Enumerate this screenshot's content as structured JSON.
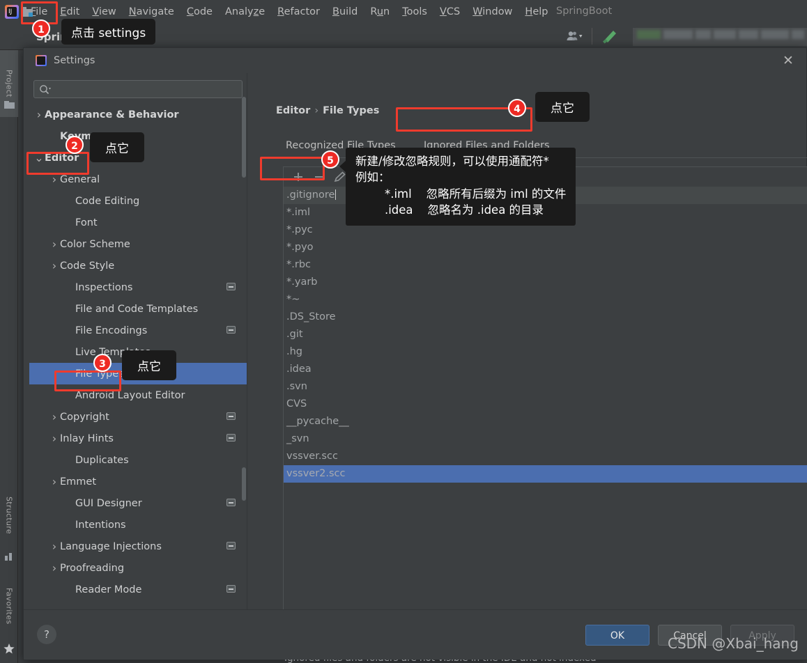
{
  "ide": {
    "menu_items": [
      {
        "label": "File",
        "mnemonic": "F"
      },
      {
        "label": "Edit",
        "mnemonic": "E"
      },
      {
        "label": "View",
        "mnemonic": "V"
      },
      {
        "label": "Navigate",
        "mnemonic": "N"
      },
      {
        "label": "Code",
        "mnemonic": "C"
      },
      {
        "label": "Analyze",
        "mnemonic": "z"
      },
      {
        "label": "Refactor",
        "mnemonic": "R"
      },
      {
        "label": "Build",
        "mnemonic": "B"
      },
      {
        "label": "Run",
        "mnemonic": "u"
      },
      {
        "label": "Tools",
        "mnemonic": "T"
      },
      {
        "label": "VCS",
        "mnemonic": "V"
      },
      {
        "label": "Window",
        "mnemonic": "W"
      },
      {
        "label": "Help",
        "mnemonic": "H"
      }
    ],
    "project_name": "SpringBoot",
    "toolbar_project_label": "SpringBoot",
    "tool_strips": [
      {
        "label": "Project",
        "icon": "folder-icon",
        "active": true
      },
      {
        "label": "Structure",
        "icon": "structure-icon",
        "active": false
      },
      {
        "label": "Favorites",
        "icon": "star-icon",
        "active": false
      }
    ]
  },
  "dialog": {
    "title": "Settings",
    "close_icon": "close-icon",
    "search": {
      "value": "",
      "placeholder": "",
      "icon": "search-icon"
    },
    "tree": [
      {
        "label": "Appearance & Behavior",
        "arrow": "collapsed",
        "indent": 0,
        "bold": true,
        "badge": false
      },
      {
        "label": "Keymap",
        "arrow": "none",
        "indent": 1,
        "bold": true,
        "badge": false
      },
      {
        "label": "Editor",
        "arrow": "expanded",
        "indent": 0,
        "bold": true,
        "badge": false
      },
      {
        "label": "General",
        "arrow": "collapsed",
        "indent": 1,
        "bold": false,
        "badge": false
      },
      {
        "label": "Code Editing",
        "arrow": "none",
        "indent": 2,
        "bold": false,
        "badge": false
      },
      {
        "label": "Font",
        "arrow": "none",
        "indent": 2,
        "bold": false,
        "badge": false
      },
      {
        "label": "Color Scheme",
        "arrow": "collapsed",
        "indent": 1,
        "bold": false,
        "badge": false
      },
      {
        "label": "Code Style",
        "arrow": "collapsed",
        "indent": 1,
        "bold": false,
        "badge": false
      },
      {
        "label": "Inspections",
        "arrow": "none",
        "indent": 2,
        "bold": false,
        "badge": true
      },
      {
        "label": "File and Code Templates",
        "arrow": "none",
        "indent": 2,
        "bold": false,
        "badge": false
      },
      {
        "label": "File Encodings",
        "arrow": "none",
        "indent": 2,
        "bold": false,
        "badge": true
      },
      {
        "label": "Live Templates",
        "arrow": "none",
        "indent": 2,
        "bold": false,
        "badge": false
      },
      {
        "label": "File Types",
        "arrow": "none",
        "indent": 2,
        "bold": false,
        "badge": false,
        "selected": true
      },
      {
        "label": "Android Layout Editor",
        "arrow": "none",
        "indent": 2,
        "bold": false,
        "badge": false
      },
      {
        "label": "Copyright",
        "arrow": "collapsed",
        "indent": 1,
        "bold": false,
        "badge": true
      },
      {
        "label": "Inlay Hints",
        "arrow": "collapsed",
        "indent": 1,
        "bold": false,
        "badge": true
      },
      {
        "label": "Duplicates",
        "arrow": "none",
        "indent": 2,
        "bold": false,
        "badge": false
      },
      {
        "label": "Emmet",
        "arrow": "collapsed",
        "indent": 1,
        "bold": false,
        "badge": false
      },
      {
        "label": "GUI Designer",
        "arrow": "none",
        "indent": 2,
        "bold": false,
        "badge": true
      },
      {
        "label": "Intentions",
        "arrow": "none",
        "indent": 2,
        "bold": false,
        "badge": false
      },
      {
        "label": "Language Injections",
        "arrow": "collapsed",
        "indent": 1,
        "bold": false,
        "badge": true
      },
      {
        "label": "Proofreading",
        "arrow": "collapsed",
        "indent": 1,
        "bold": false,
        "badge": false
      },
      {
        "label": "Reader Mode",
        "arrow": "none",
        "indent": 2,
        "bold": false,
        "badge": true
      }
    ],
    "breadcrumb": {
      "root": "Editor",
      "separator": "›",
      "leaf": "File Types"
    },
    "tabs": [
      {
        "label": "Recognized File Types",
        "active": false
      },
      {
        "label": "Ignored Files and Folders",
        "active": true
      }
    ],
    "list_toolbar": [
      {
        "icon": "plus-icon",
        "name": "add-button"
      },
      {
        "icon": "minus-icon",
        "name": "remove-button"
      },
      {
        "icon": "pencil-icon",
        "name": "edit-button"
      }
    ],
    "ignored_items": [
      {
        "value": ".gitignore",
        "state": "editing"
      },
      {
        "value": "*.iml",
        "state": "normal"
      },
      {
        "value": "*.pyc",
        "state": "normal"
      },
      {
        "value": "*.pyo",
        "state": "normal"
      },
      {
        "value": "*.rbc",
        "state": "normal"
      },
      {
        "value": "*.yarb",
        "state": "normal"
      },
      {
        "value": "*~",
        "state": "normal"
      },
      {
        "value": ".DS_Store",
        "state": "normal"
      },
      {
        "value": ".git",
        "state": "normal"
      },
      {
        "value": ".hg",
        "state": "normal"
      },
      {
        "value": ".idea",
        "state": "normal"
      },
      {
        "value": ".svn",
        "state": "normal"
      },
      {
        "value": "CVS",
        "state": "normal"
      },
      {
        "value": "__pycache__",
        "state": "normal"
      },
      {
        "value": "_svn",
        "state": "normal"
      },
      {
        "value": "vssver.scc",
        "state": "normal"
      },
      {
        "value": "vssver2.scc",
        "state": "selected"
      }
    ],
    "hint": "Ignored files and folders are not visible in the IDE and not indexed",
    "footer": {
      "help_label": "?",
      "ok_label": "OK",
      "cancel_label": "Cancel",
      "apply_label": "Apply"
    }
  },
  "annotations": {
    "badges": [
      "1",
      "2",
      "3",
      "4",
      "5"
    ],
    "callout_1": "点击 settings",
    "callout_2": "点它",
    "callout_3": "点它",
    "callout_4": "点它",
    "tooltip_5": "新建/修改忽略规则，可以使用通配符*\n例如：\n        *.iml    忽略所有后缀为 iml 的文件\n        .idea    忽略名为 .idea 的目录",
    "accent_red": "#ee2a24",
    "accent_blue": "#4b6eaf"
  },
  "watermark": "CSDN @Xbai_hang"
}
